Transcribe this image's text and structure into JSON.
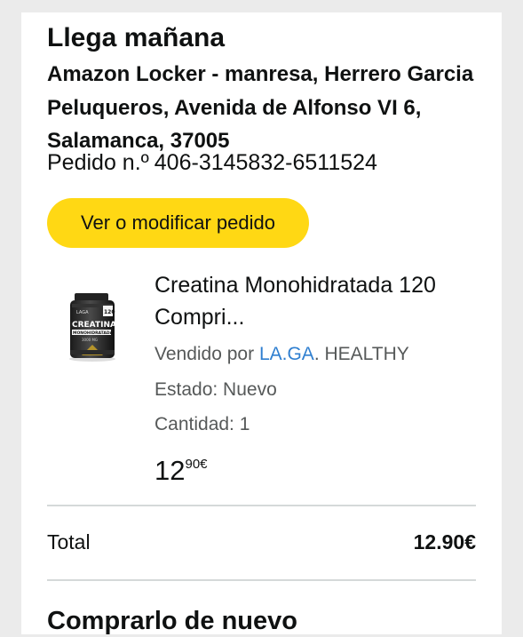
{
  "delivery": {
    "title": "Llega mañana",
    "address": "Amazon Locker - manresa, Herrero Garcia Peluqueros, Avenida de Alfonso VI 6, Salamanca, 37005",
    "order_label": "Pedido n.º",
    "order_id": "406-3145832-6511524"
  },
  "actions": {
    "manage_order": "Ver o modificar pedido"
  },
  "product": {
    "title": "Creatina Monohidratada 120 Compri...",
    "sold_by_prefix": "Vendido por",
    "seller_link": "LA.GA",
    "seller_rest": ". HEALTHY",
    "condition": "Estado: Nuevo",
    "quantity": "Cantidad: 1",
    "price_whole": "12",
    "price_fraction": "90€",
    "image_text": {
      "brand": "LAGA",
      "label_main": "CREATINA",
      "label_sub": "MONOHIDRATADA",
      "dose": "3000 MG",
      "count": "120"
    }
  },
  "summary": {
    "total_label": "Total",
    "total_value": "12.90€"
  },
  "section": {
    "buy_again": "Comprarlo de nuevo"
  },
  "colors": {
    "accent_yellow": "#ffd814",
    "link_blue": "#2f7fd0",
    "text": "#0f1111",
    "muted": "#565959",
    "background": "#ebebeb"
  }
}
